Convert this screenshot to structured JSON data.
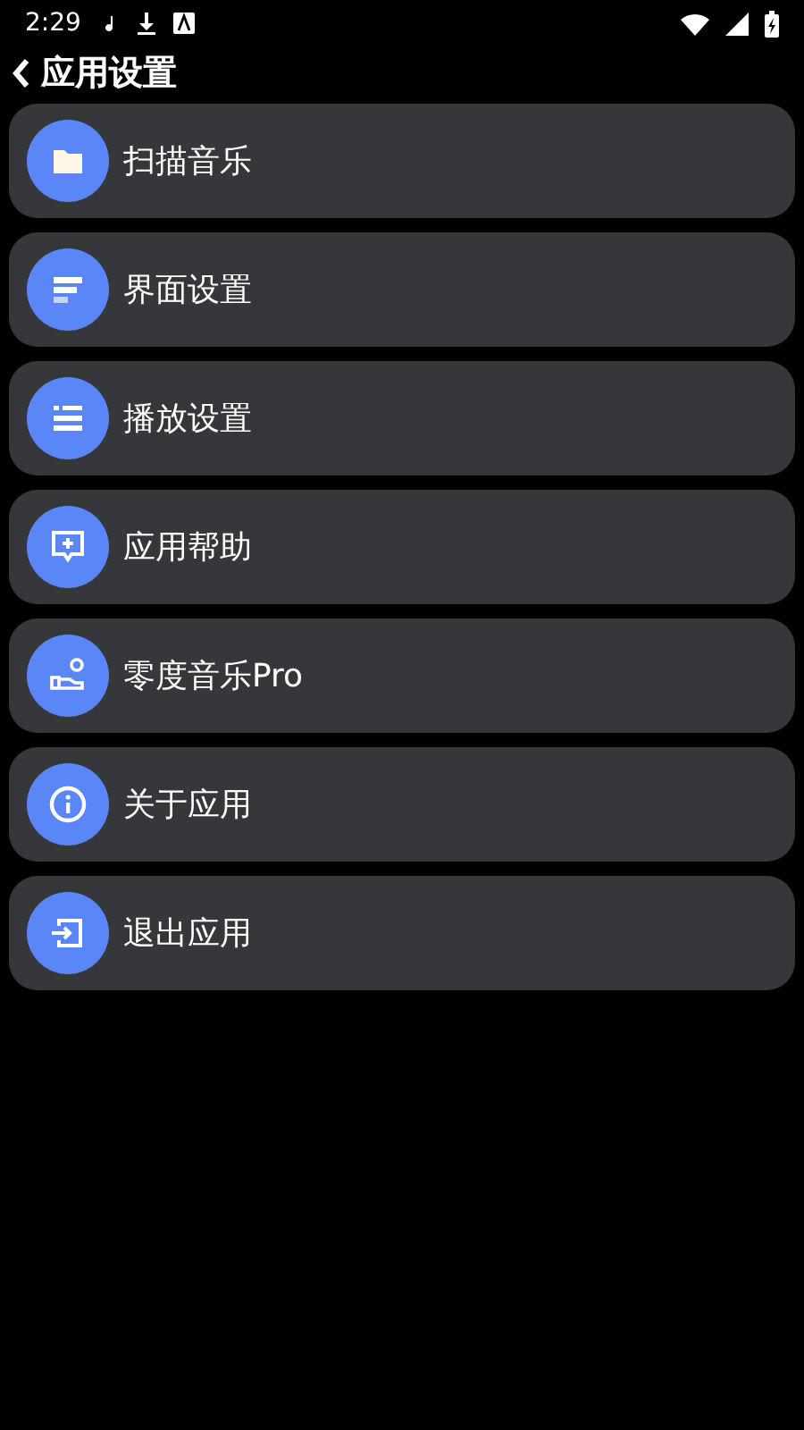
{
  "status_bar": {
    "time": "2:29"
  },
  "header": {
    "title": "应用设置"
  },
  "items": [
    {
      "label": "扫描音乐",
      "kind": "folder"
    },
    {
      "label": "界面设置",
      "kind": "layout"
    },
    {
      "label": "播放设置",
      "kind": "list"
    },
    {
      "label": "应用帮助",
      "kind": "help"
    },
    {
      "label": "零度音乐Pro",
      "kind": "pro"
    },
    {
      "label": "关于应用",
      "kind": "info"
    },
    {
      "label": "退出应用",
      "kind": "exit"
    }
  ]
}
